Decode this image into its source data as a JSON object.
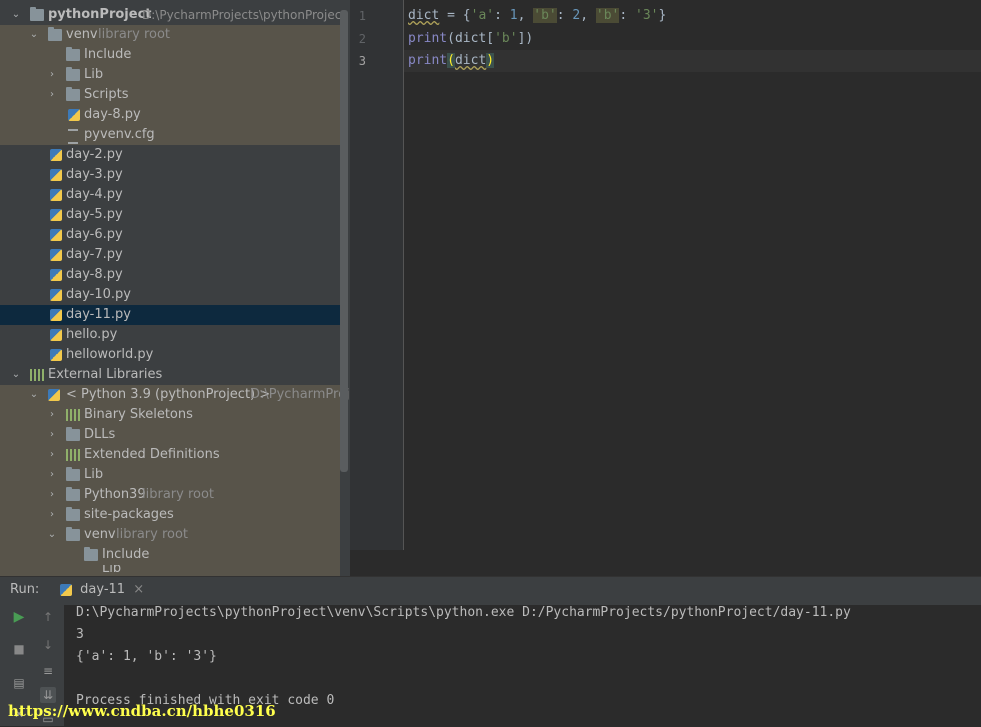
{
  "project_tree": {
    "root": {
      "label": "pythonProject",
      "hint": "D:\\PycharmProjects\\pythonProject"
    },
    "venv": {
      "label": "venv",
      "hint": "library root"
    },
    "venv_children": [
      "Include",
      "Lib",
      "Scripts",
      "day-8.py",
      "pyvenv.cfg"
    ],
    "files": [
      "day-2.py",
      "day-3.py",
      "day-4.py",
      "day-5.py",
      "day-6.py",
      "day-7.py",
      "day-8.py",
      "day-10.py",
      "day-11.py",
      "hello.py",
      "helloworld.py"
    ],
    "external": {
      "label": "External Libraries"
    },
    "python": {
      "label": "< Python 3.9 (pythonProject) >",
      "hint": "D:\\PycharmProjec"
    },
    "python_children": [
      {
        "label": "Binary Skeletons",
        "hint": ""
      },
      {
        "label": "DLLs",
        "hint": ""
      },
      {
        "label": "Extended Definitions",
        "hint": ""
      },
      {
        "label": "Lib",
        "hint": ""
      },
      {
        "label": "Python39",
        "hint": "library root"
      },
      {
        "label": "site-packages",
        "hint": ""
      },
      {
        "label": "venv",
        "hint": "library root"
      }
    ],
    "inner_include": "Include",
    "partial_lib": "Lib"
  },
  "editor": {
    "line_numbers": [
      "1",
      "2",
      "3"
    ],
    "lines": [
      "dict = {'a': 1, 'b': 2, 'b': '3'}",
      "print(dict['b'])",
      "print(dict)"
    ]
  },
  "run": {
    "label": "Run:",
    "tab": "day-11",
    "close": "×",
    "output": [
      "D:\\PycharmProjects\\pythonProject\\venv\\Scripts\\python.exe D:/PycharmProjects/pythonProject/day-11.py",
      "3",
      "{'a': 1, 'b': '3'}",
      "",
      "Process finished with exit code 0"
    ]
  },
  "watermark": "https://www.cndba.cn/hbhe0316",
  "colors": {
    "selection": "#0d293e",
    "library_bg": "#58544a",
    "run_green": "#499c54"
  }
}
